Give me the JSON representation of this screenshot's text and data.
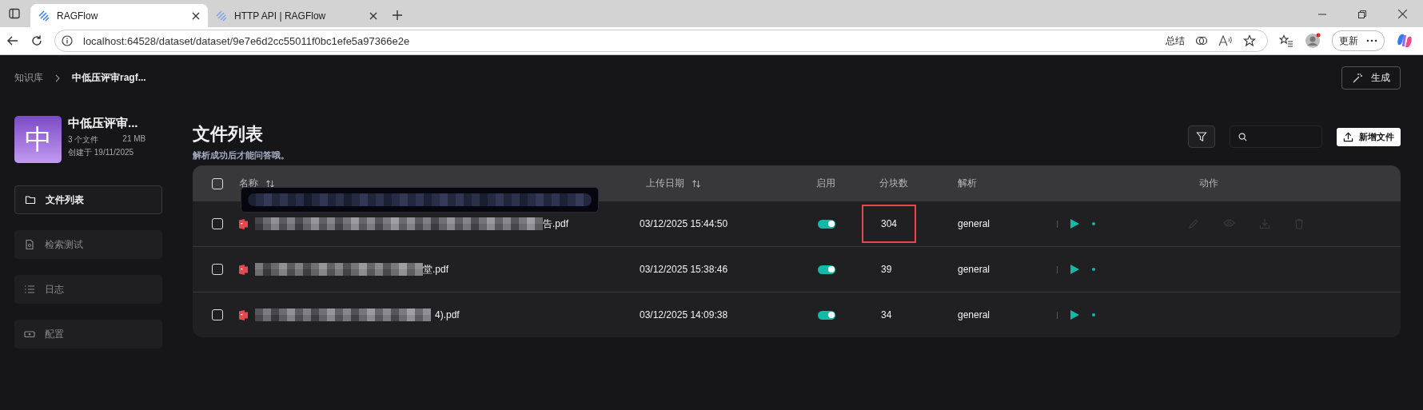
{
  "browser": {
    "tabs": [
      {
        "title": "RAGFlow",
        "selected": true
      },
      {
        "title": "HTTP API | RAGFlow",
        "selected": false
      }
    ],
    "url": "localhost:64528/dataset/dataset/9e7e6d2cc55011f0bc1efe5a97366e2e",
    "summarize": "总结",
    "update": "更新"
  },
  "breadcrumb": [
    "知识库",
    "中低压评审ragf..."
  ],
  "generate_button": "生成",
  "dataset": {
    "avatar": "中",
    "name": "中低压评审...",
    "file_count": "3 个文件",
    "size": "21 MB",
    "created": "创建于 19/11/2025"
  },
  "sidebar": {
    "items": [
      {
        "label": "文件列表",
        "kind": "folder",
        "selected": true
      },
      {
        "label": "检索测试",
        "kind": "search-file",
        "selected": false
      },
      {
        "label": "日志",
        "kind": "list",
        "selected": false
      },
      {
        "label": "配置",
        "kind": "settings",
        "selected": false
      }
    ]
  },
  "page": {
    "title": "文件列表",
    "subtitle": "解析成功后才能问答哦。"
  },
  "upload_button": "新增文件",
  "table": {
    "checked": false,
    "columns": [
      {
        "label": "名称",
        "sortable": true
      },
      {
        "label": "上传日期",
        "sortable": true
      },
      {
        "label": "启用",
        "sortable": false
      },
      {
        "label": "分块数",
        "sortable": false
      },
      {
        "label": "解析",
        "sortable": false
      },
      {
        "label": "动作",
        "sortable": false
      }
    ],
    "rows": [
      {
        "name": "告.pdf",
        "uploaded": "03/12/2025 15:44:50",
        "enabled": true,
        "chunks": "304",
        "parser": "general",
        "checked": false,
        "highlighted": true,
        "hovered": true,
        "tooltip": true
      },
      {
        "name": "堂.pdf",
        "uploaded": "03/12/2025 15:38:46",
        "enabled": true,
        "chunks": "39",
        "parser": "general",
        "checked": false,
        "highlighted": false,
        "hovered": false,
        "tooltip": false
      },
      {
        "name": "4).pdf",
        "uploaded": "03/12/2025 14:09:38",
        "enabled": true,
        "chunks": "34",
        "parser": "general",
        "checked": false,
        "highlighted": false,
        "hovered": false,
        "tooltip": false
      }
    ]
  }
}
